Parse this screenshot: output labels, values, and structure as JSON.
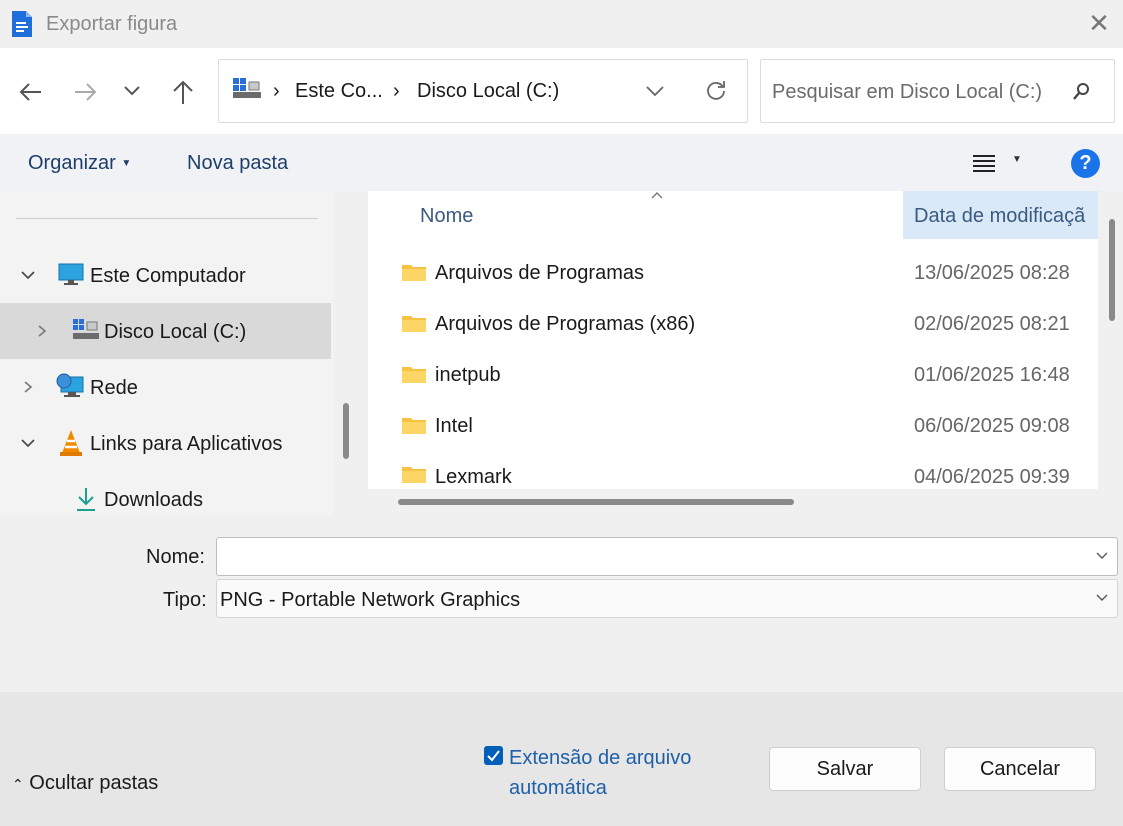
{
  "window": {
    "title": "Exportar figura"
  },
  "address": {
    "segment1": "Este Co...",
    "segment2": "Disco Local (C:)"
  },
  "search": {
    "placeholder": "Pesquisar em Disco Local (C:)"
  },
  "toolbar": {
    "organize": "Organizar",
    "new_folder": "Nova pasta",
    "help": "?"
  },
  "sidebar": {
    "items": [
      {
        "label": "Este Computador",
        "expanded": true
      },
      {
        "label": "Disco Local (C:)",
        "selected": true
      },
      {
        "label": "Rede",
        "expanded": false
      },
      {
        "label": "Links para Aplicativos",
        "expanded": true
      },
      {
        "label": "Downloads"
      }
    ]
  },
  "file_list": {
    "columns": {
      "name": "Nome",
      "date": "Data de modificaçã"
    },
    "rows": [
      {
        "name": "Arquivos de Programas",
        "date": "13/06/2025 08:28"
      },
      {
        "name": "Arquivos de Programas (x86)",
        "date": "02/06/2025 08:21"
      },
      {
        "name": "inetpub",
        "date": "01/06/2025 16:48"
      },
      {
        "name": "Intel",
        "date": "06/06/2025 09:08"
      },
      {
        "name": "Lexmark",
        "date": "04/06/2025 09:39"
      }
    ]
  },
  "form": {
    "name_label": "Nome:",
    "name_value": "",
    "type_label": "Tipo:",
    "type_value": "PNG - Portable Network Graphics"
  },
  "footer": {
    "hide_folders": "Ocultar pastas",
    "auto_ext_line1": "Extensão de arquivo",
    "auto_ext_line2": "automática",
    "auto_ext_checked": true,
    "save": "Salvar",
    "cancel": "Cancelar"
  },
  "colors": {
    "accent": "#005fb8",
    "selected_row": "#d9d9d9",
    "column_highlight": "#d9e9f7"
  }
}
